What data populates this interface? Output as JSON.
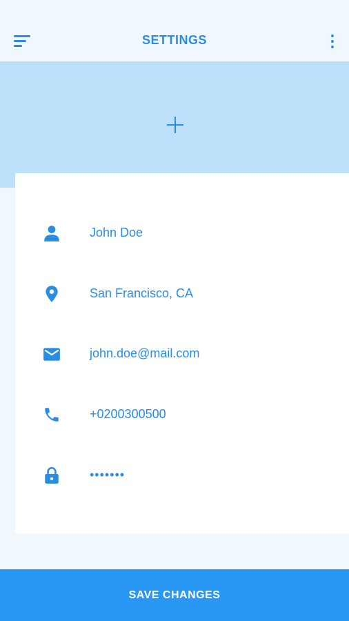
{
  "header": {
    "title": "SETTINGS",
    "menu_icon": "menu-icon",
    "more_icon": "more-vertical-icon"
  },
  "banner": {
    "add_icon": "plus-icon"
  },
  "profile": {
    "fields": [
      {
        "icon": "person-icon",
        "value": "John Doe"
      },
      {
        "icon": "location-icon",
        "value": "San Francisco, CA"
      },
      {
        "icon": "email-icon",
        "value": "john.doe@mail.com"
      },
      {
        "icon": "phone-icon",
        "value": "+0200300500"
      },
      {
        "icon": "lock-icon",
        "value": "•••••••"
      }
    ]
  },
  "footer": {
    "save_label": "SAVE CHANGES"
  },
  "colors": {
    "accent": "#2b8de0",
    "banner": "#bde0fb",
    "background": "#f0f7fd",
    "button": "#2898f4"
  }
}
